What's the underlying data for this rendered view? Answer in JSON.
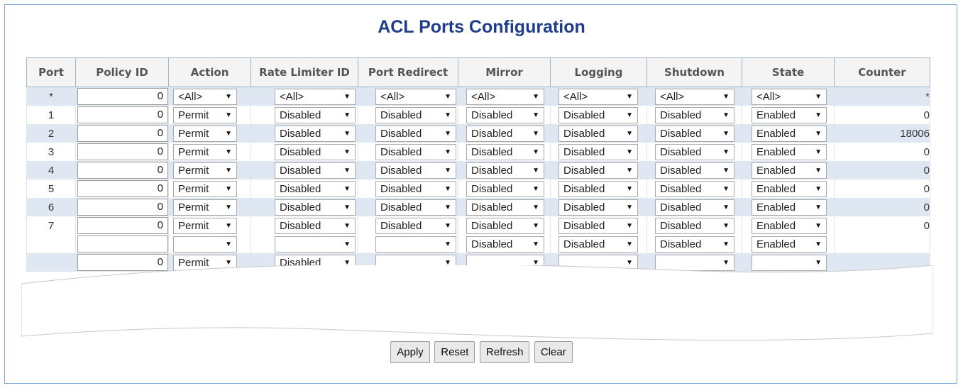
{
  "page": {
    "title": "ACL Ports Configuration"
  },
  "table": {
    "headers": [
      "Port",
      "Policy ID",
      "Action",
      "Rate Limiter ID",
      "Port Redirect",
      "Mirror",
      "Logging",
      "Shutdown",
      "State",
      "Counter"
    ],
    "wildcard_row": {
      "port": "*",
      "policy_id": "0",
      "action": "<All>",
      "rate_limiter": "<All>",
      "port_redirect": "<All>",
      "mirror": "<All>",
      "logging": "<All>",
      "shutdown": "<All>",
      "state": "<All>",
      "counter": "*"
    },
    "rows": [
      {
        "port": "1",
        "policy_id": "0",
        "action": "Permit",
        "rate_limiter": "Disabled",
        "port_redirect": "Disabled",
        "mirror": "Disabled",
        "logging": "Disabled",
        "shutdown": "Disabled",
        "state": "Enabled",
        "counter": "0"
      },
      {
        "port": "2",
        "policy_id": "0",
        "action": "Permit",
        "rate_limiter": "Disabled",
        "port_redirect": "Disabled",
        "mirror": "Disabled",
        "logging": "Disabled",
        "shutdown": "Disabled",
        "state": "Enabled",
        "counter": "18006"
      },
      {
        "port": "3",
        "policy_id": "0",
        "action": "Permit",
        "rate_limiter": "Disabled",
        "port_redirect": "Disabled",
        "mirror": "Disabled",
        "logging": "Disabled",
        "shutdown": "Disabled",
        "state": "Enabled",
        "counter": "0"
      },
      {
        "port": "4",
        "policy_id": "0",
        "action": "Permit",
        "rate_limiter": "Disabled",
        "port_redirect": "Disabled",
        "mirror": "Disabled",
        "logging": "Disabled",
        "shutdown": "Disabled",
        "state": "Enabled",
        "counter": "0"
      },
      {
        "port": "5",
        "policy_id": "0",
        "action": "Permit",
        "rate_limiter": "Disabled",
        "port_redirect": "Disabled",
        "mirror": "Disabled",
        "logging": "Disabled",
        "shutdown": "Disabled",
        "state": "Enabled",
        "counter": "0"
      },
      {
        "port": "6",
        "policy_id": "0",
        "action": "Permit",
        "rate_limiter": "Disabled",
        "port_redirect": "Disabled",
        "mirror": "Disabled",
        "logging": "Disabled",
        "shutdown": "Disabled",
        "state": "Enabled",
        "counter": "0"
      },
      {
        "port": "7",
        "policy_id": "0",
        "action": "Permit",
        "rate_limiter": "Disabled",
        "port_redirect": "Disabled",
        "mirror": "Disabled",
        "logging": "Disabled",
        "shutdown": "Disabled",
        "state": "Enabled",
        "counter": "0"
      }
    ],
    "truncated_rows": [
      {
        "policy_id": "",
        "action": "",
        "rate_limiter": "",
        "port_redirect": "",
        "mirror": "Disabled",
        "logging": "Disabled",
        "shutdown": "Disabled",
        "state": "Enabled"
      },
      {
        "policy_id": "0",
        "action": "Permit",
        "rate_limiter": "Disabled",
        "port_redirect": "",
        "mirror": "",
        "logging": "",
        "shutdown": "",
        "state": ""
      }
    ]
  },
  "buttons": {
    "apply": "Apply",
    "reset": "Reset",
    "refresh": "Refresh",
    "clear": "Clear"
  },
  "icons": {
    "dropdown": "dropdown-arrow-icon"
  },
  "colors": {
    "title": "#1e3e8c",
    "frame_border": "#7aa6d6",
    "row_alt": "#dfe7f2",
    "header_bg": "#f4f4f4"
  }
}
